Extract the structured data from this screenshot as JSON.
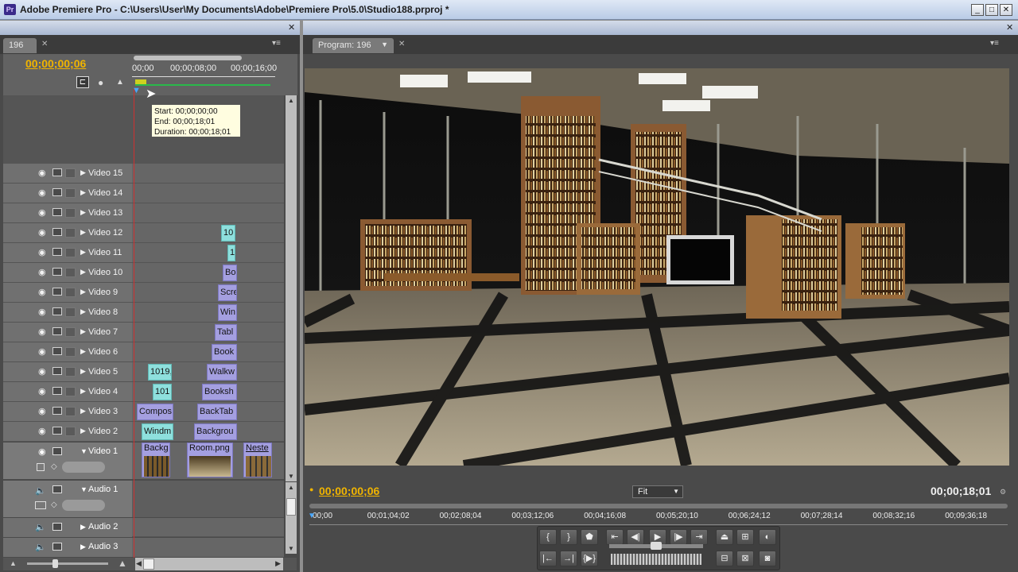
{
  "window": {
    "title": "Adobe Premiere Pro - C:\\Users\\User\\My Documents\\Adobe\\Premiere Pro\\5.0\\Studio188.prproj *",
    "app_icon": "Pr"
  },
  "timeline": {
    "tab": "196",
    "timecode": "00;00;00;06",
    "ruler": [
      "00;00",
      "00;00;08;00",
      "00;00;16;00"
    ],
    "tooltip": {
      "start": "Start: 00;00;00;00",
      "end": "End: 00;00;18;01",
      "duration": "Duration: 00;00;18;01"
    },
    "video_tracks": [
      {
        "name": "Video 15",
        "clips": []
      },
      {
        "name": "Video 14",
        "clips": []
      },
      {
        "name": "Video 13",
        "clips": []
      },
      {
        "name": "Video 12",
        "clips": [
          {
            "label": "10",
            "color": "cyan"
          }
        ]
      },
      {
        "name": "Video 11",
        "clips": [
          {
            "label": "1(",
            "color": "cyan"
          }
        ]
      },
      {
        "name": "Video 10",
        "clips": [
          {
            "label": "Bo",
            "color": "purple"
          }
        ]
      },
      {
        "name": "Video 9",
        "clips": [
          {
            "label": "Scre",
            "color": "purple"
          }
        ]
      },
      {
        "name": "Video 8",
        "clips": [
          {
            "label": "Win",
            "color": "purple"
          }
        ]
      },
      {
        "name": "Video 7",
        "clips": [
          {
            "label": "Tabl",
            "color": "purple"
          }
        ]
      },
      {
        "name": "Video 6",
        "clips": [
          {
            "label": "Book",
            "color": "purple"
          }
        ]
      },
      {
        "name": "Video 5",
        "clips": [
          {
            "label": "1019,",
            "color": "cyan"
          },
          {
            "label": "Walkw",
            "color": "purple"
          }
        ]
      },
      {
        "name": "Video 4",
        "clips": [
          {
            "label": "101",
            "color": "cyan"
          },
          {
            "label": "Booksh",
            "color": "purple"
          }
        ]
      },
      {
        "name": "Video 3",
        "clips": [
          {
            "label": "Compos",
            "color": "purple"
          },
          {
            "label": "BackTab",
            "color": "purple"
          }
        ]
      },
      {
        "name": "Video 2",
        "clips": [
          {
            "label": "Windm",
            "color": "cyan"
          },
          {
            "label": "Backgrou",
            "color": "purple"
          }
        ]
      }
    ],
    "video1": {
      "name": "Video 1",
      "clips": [
        "Backg",
        "Room.png",
        "Neste"
      ]
    },
    "audio_tracks": [
      "Audio 1",
      "Audio 2",
      "Audio 3"
    ]
  },
  "program": {
    "tab": "Program: 196",
    "timecode": "00;00;00;06",
    "duration": "00;00;18;01",
    "zoom": "Fit",
    "ruler": [
      "00;00",
      "00;01;04;02",
      "00;02;08;04",
      "00;03;12;06",
      "00;04;16;08",
      "00;05;20;10",
      "00;06;24;12",
      "00;07;28;14",
      "00;08;32;16",
      "00;09;36;18"
    ],
    "controls_row1": [
      "{",
      "}",
      "marker-icon",
      "go-in",
      "step-back",
      "play",
      "step-forward",
      "go-out",
      "lift",
      "extract",
      "safe-margins"
    ],
    "controls_row2": [
      "go-prev-edit",
      "go-next-edit",
      "play-in-out",
      "insert",
      "overlay",
      "export-frame"
    ]
  }
}
